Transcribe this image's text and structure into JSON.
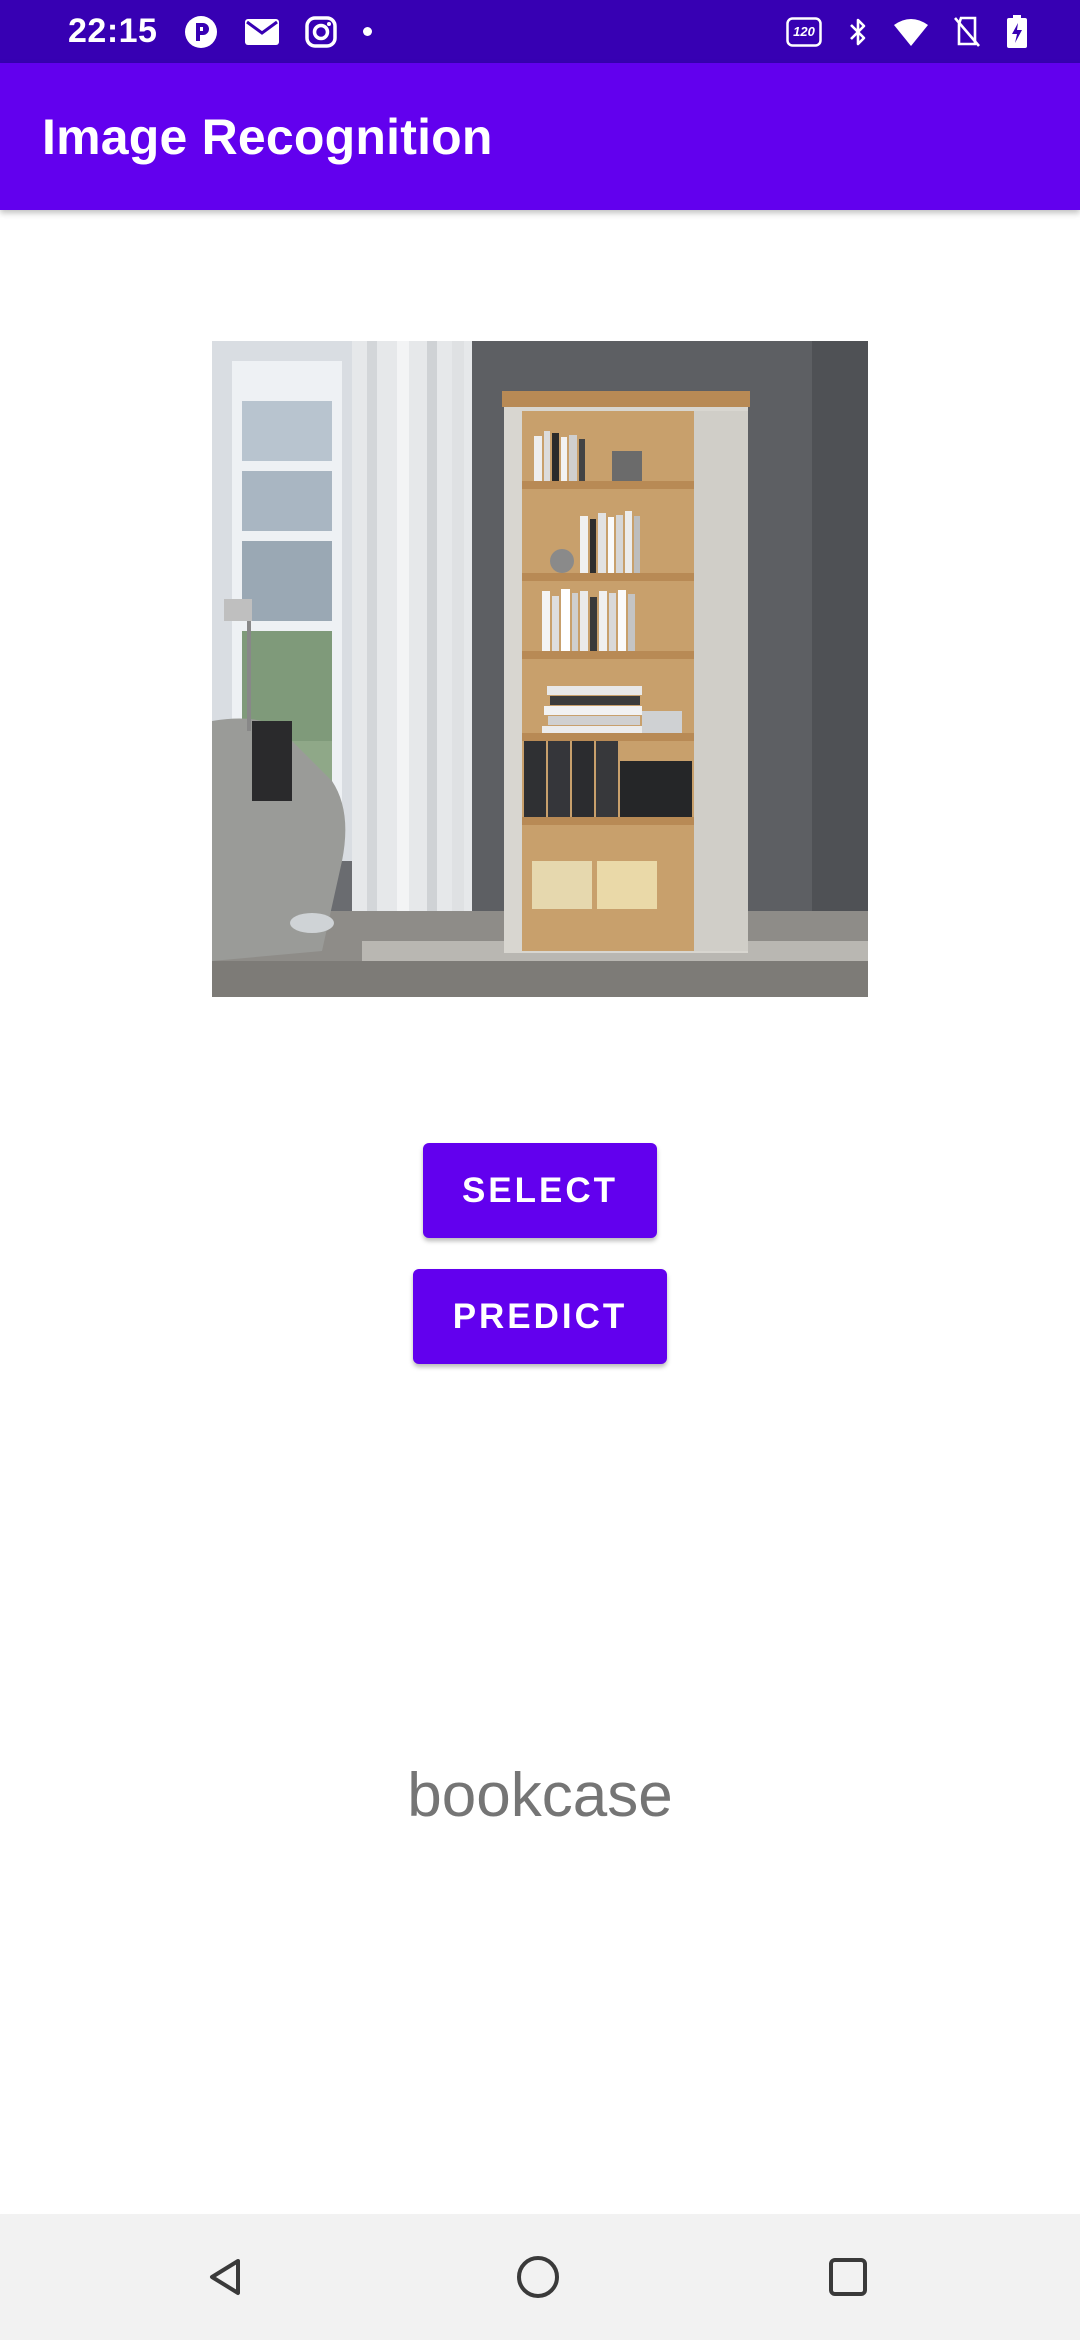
{
  "status_bar": {
    "time": "22:15",
    "left_icons": [
      "app-notification-icon",
      "mail-icon",
      "instagram-icon",
      "more-dot-icon"
    ],
    "right_icons": [
      "refresh-rate-120hz-icon",
      "bluetooth-icon",
      "wifi-icon",
      "no-sim-icon",
      "battery-charging-icon"
    ],
    "refresh_rate_label": "120"
  },
  "app_bar": {
    "title": "Image Recognition",
    "color": "#6200ee"
  },
  "photo": {
    "subject": "bookcase in living room"
  },
  "buttons": {
    "select_label": "SELECT",
    "predict_label": "PREDICT"
  },
  "result": {
    "label": "bookcase"
  },
  "nav_bar": {
    "icons": [
      "back-icon",
      "home-icon",
      "recents-icon"
    ]
  },
  "colors": {
    "status_bar": "#3700b3",
    "primary": "#6200ee",
    "result_text": "#757575"
  }
}
